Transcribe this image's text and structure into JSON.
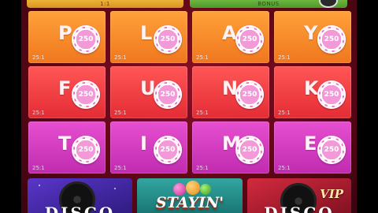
{
  "top_bars": {
    "left_label": "1:1",
    "right_label": "BONUS"
  },
  "rows": [
    {
      "cells": [
        {
          "letter": "P",
          "payout": "25:1",
          "chip": "250"
        },
        {
          "letter": "L",
          "payout": "25:1",
          "chip": "250"
        },
        {
          "letter": "A",
          "payout": "25:1",
          "chip": "250"
        },
        {
          "letter": "Y",
          "payout": "25:1",
          "chip": "250"
        }
      ]
    },
    {
      "cells": [
        {
          "letter": "F",
          "payout": "25:1",
          "chip": "250"
        },
        {
          "letter": "U",
          "payout": "25:1",
          "chip": "250"
        },
        {
          "letter": "N",
          "payout": "25:1",
          "chip": "250"
        },
        {
          "letter": "K",
          "payout": "25:1",
          "chip": "250"
        }
      ]
    },
    {
      "cells": [
        {
          "letter": "T",
          "payout": "25:1",
          "chip": "250"
        },
        {
          "letter": "I",
          "payout": "25:1",
          "chip": "250"
        },
        {
          "letter": "M",
          "payout": "25:1",
          "chip": "250"
        },
        {
          "letter": "E",
          "payout": "25:1",
          "chip": "250"
        }
      ]
    }
  ],
  "bonus_tiles": [
    {
      "title": "DISCO"
    },
    {
      "title": "STAYIN'"
    },
    {
      "title": "DISCO",
      "badge": "VIP"
    }
  ],
  "colors": {
    "row_1": "#f0771e",
    "row_2": "#e42c34",
    "row_3": "#c02bb0",
    "chip": "#e56ac2"
  }
}
